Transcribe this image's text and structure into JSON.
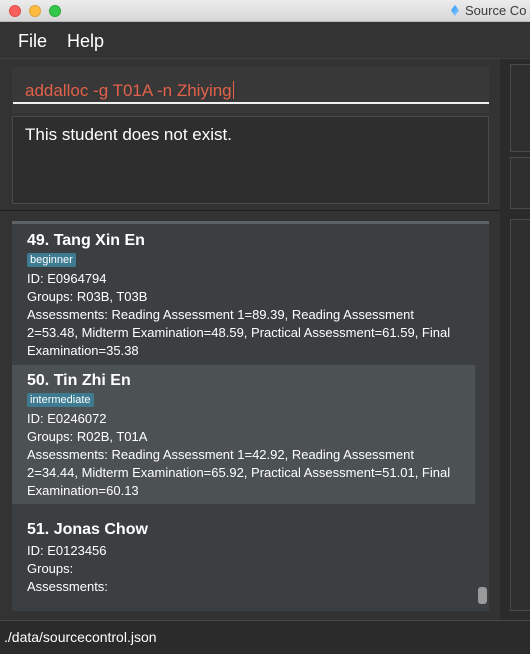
{
  "window": {
    "title": "Source Co"
  },
  "menu": {
    "file": "File",
    "help": "Help"
  },
  "command": {
    "text": "addalloc -g T01A -n Zhiying"
  },
  "result": {
    "message": "This student does not exist."
  },
  "students": [
    {
      "name": "49.  Tang Xin En",
      "tag": "beginner",
      "id": "ID: E0964794",
      "groups": "Groups: R03B, T03B",
      "assessments_line1": "Assessments: Reading Assessment 1=89.39, Reading Assessment",
      "assessments_line2": "2=53.48, Midterm Examination=48.59, Practical Assessment=61.59, Final",
      "assessments_line3": "Examination=35.38"
    },
    {
      "name": "50.  Tin Zhi En",
      "tag": "intermediate",
      "id": "ID: E0246072",
      "groups": "Groups: R02B, T01A",
      "assessments_line1": "Assessments: Reading Assessment 1=42.92, Reading Assessment",
      "assessments_line2": "2=34.44, Midterm Examination=65.92, Practical Assessment=51.01, Final",
      "assessments_line3": "Examination=60.13"
    },
    {
      "name": "51.  Jonas Chow",
      "id": "ID: E0123456",
      "groups": "Groups:",
      "assessments": "Assessments:"
    }
  ],
  "status": {
    "path": "./data/sourcecontrol.json"
  },
  "colors": {
    "tag_bg": "#3e7b91",
    "command_text": "#e2614a",
    "selected_card": "#4c5153"
  }
}
